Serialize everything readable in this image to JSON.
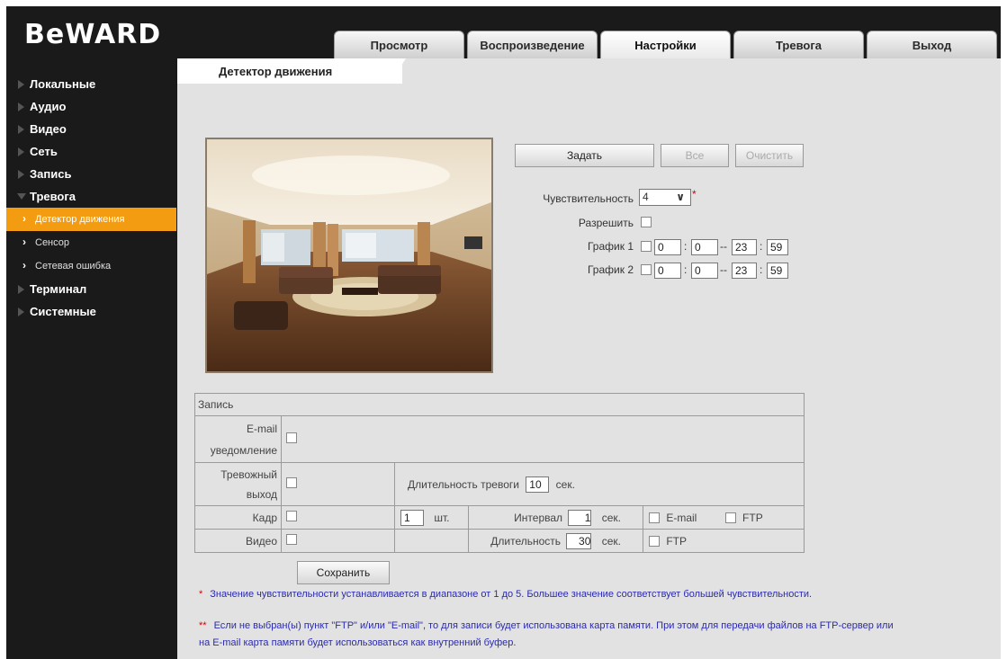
{
  "header": {
    "logo": "BeWARD",
    "tabs": [
      {
        "label": "Просмотр"
      },
      {
        "label": "Воспроизведение"
      },
      {
        "label": "Настройки"
      },
      {
        "label": "Тревога"
      },
      {
        "label": "Выход"
      }
    ]
  },
  "sidebar": {
    "items": [
      {
        "label": "Локальные"
      },
      {
        "label": "Аудио"
      },
      {
        "label": "Видео"
      },
      {
        "label": "Сеть"
      },
      {
        "label": "Запись"
      },
      {
        "label": "Тревога"
      }
    ],
    "subitems": [
      {
        "label": "Детектор движения"
      },
      {
        "label": "Сенсор"
      },
      {
        "label": "Сетевая ошибка"
      }
    ],
    "items_after": [
      {
        "label": "Терминал"
      },
      {
        "label": "Системные"
      }
    ]
  },
  "main": {
    "tab_title": "Детектор движения",
    "buttons": {
      "set": "Задать",
      "all": "Все",
      "clear": "Очистить",
      "save": "Сохранить"
    },
    "sensitivity": {
      "label": "Чувствительность",
      "value": "4",
      "required_mark": "*"
    },
    "enable": {
      "label": "Разрешить"
    },
    "schedule1": {
      "label": "График 1",
      "start_h": "0",
      "start_m": "0",
      "end_h": "23",
      "end_m": "59"
    },
    "schedule2": {
      "label": "График 2",
      "start_h": "0",
      "start_m": "0",
      "end_h": "23",
      "end_m": "59"
    },
    "time_sep": ":",
    "range_sep": "--"
  },
  "record": {
    "title": "Запись",
    "email_notify": "E-mail уведомление",
    "alarm_out": "Тревожный выход",
    "alarm_duration_label": "Длительность тревоги",
    "alarm_duration_value": "10",
    "sec": "сек.",
    "frame": "Кадр",
    "frame_count": "1",
    "pcs": "шт.",
    "interval_label": "Интервал",
    "interval_value": "1",
    "email": "E-mail",
    "ftp": "FTP",
    "video": "Видео",
    "video_duration_label": "Длительность",
    "video_duration_value": "30"
  },
  "notes": {
    "note1_mark": "*",
    "note1": "Значение чувствительности устанавливается в диапазоне от 1 до 5. Большее значение соответствует большей чувствительности.",
    "note2_mark": "**",
    "note2_line1": "Если не выбран(ы) пункт \"FTP\" и/или \"E-mail\", то для записи будет использована карта памяти. При этом для передачи файлов на FTP-сервер или",
    "note2_line2": "на E-mail карта памяти будет использоваться как внутренний буфер."
  }
}
